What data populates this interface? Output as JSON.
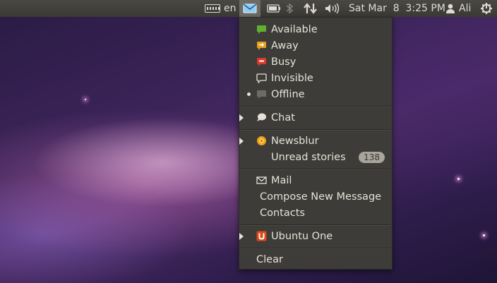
{
  "panel": {
    "keyboard_layout": "en",
    "clock": "Sat Mar  8  3:25 PM",
    "user": "Ali"
  },
  "menu": {
    "status": [
      {
        "label": "Available",
        "icon": "available-icon",
        "color": "#5fb030"
      },
      {
        "label": "Away",
        "icon": "away-icon",
        "color": "#e6a21a"
      },
      {
        "label": "Busy",
        "icon": "busy-icon",
        "color": "#d83a2a"
      },
      {
        "label": "Invisible",
        "icon": "invisible-icon",
        "color": "#c8c4bb"
      },
      {
        "label": "Offline",
        "icon": "offline-icon",
        "color": "#8a877f",
        "selected": true
      }
    ],
    "chat": {
      "label": "Chat"
    },
    "newsblur": {
      "label": "Newsblur",
      "unread_label": "Unread stories",
      "unread_count": "138"
    },
    "mail": {
      "label": "Mail",
      "compose": "Compose New Message",
      "contacts": "Contacts"
    },
    "ubuntu_one": {
      "label": "Ubuntu One",
      "color": "#dd4814"
    },
    "clear": "Clear"
  }
}
